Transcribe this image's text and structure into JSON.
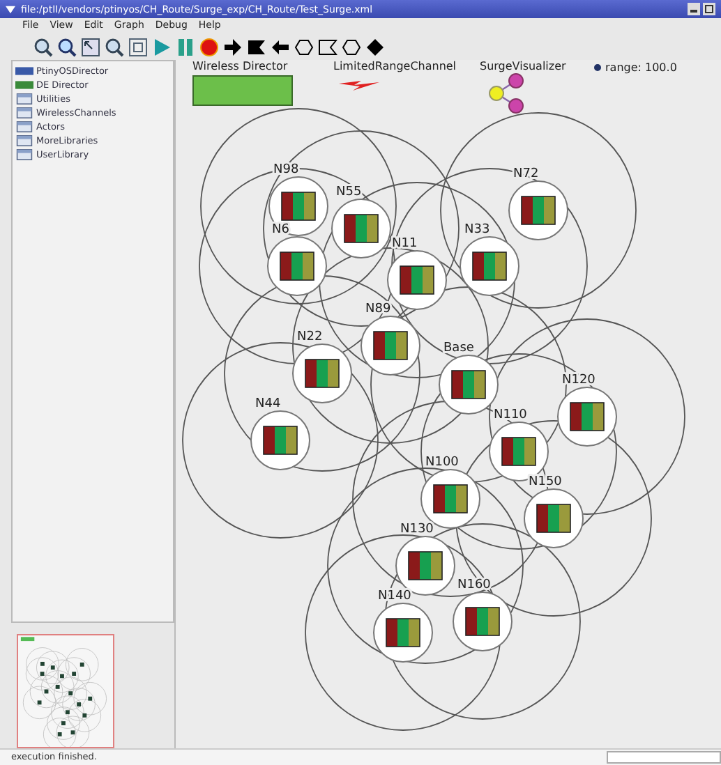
{
  "window": {
    "title": "file:/ptII/vendors/ptinyos/CH_Route/Surge_exp/CH_Route/Test_Surge.xml"
  },
  "menu": [
    "File",
    "View",
    "Edit",
    "Graph",
    "Debug",
    "Help"
  ],
  "library": [
    {
      "label": "PtinyOSDirector",
      "kind": "director",
      "color": "#3a5aa8"
    },
    {
      "label": "DE Director",
      "kind": "director",
      "color": "#3a8a3a"
    },
    {
      "label": "Utilities",
      "kind": "folder"
    },
    {
      "label": "WirelessChannels",
      "kind": "folder"
    },
    {
      "label": "Actors",
      "kind": "folder"
    },
    {
      "label": "MoreLibraries",
      "kind": "folder"
    },
    {
      "label": "UserLibrary",
      "kind": "folder"
    }
  ],
  "canvas": {
    "attributes": [
      {
        "label": "Wireless Director",
        "kind": "director"
      },
      {
        "label": "LimitedRangeChannel",
        "kind": "channel"
      },
      {
        "label": "SurgeVisualizer",
        "kind": "visualizer"
      },
      {
        "label": "range: 100.0",
        "kind": "parameter"
      }
    ],
    "nodes": [
      {
        "label": "N98"
      },
      {
        "label": "N55"
      },
      {
        "label": "N6"
      },
      {
        "label": "N11"
      },
      {
        "label": "N33"
      },
      {
        "label": "N72"
      },
      {
        "label": "N89"
      },
      {
        "label": "N22"
      },
      {
        "label": "Base"
      },
      {
        "label": "N44"
      },
      {
        "label": "N120"
      },
      {
        "label": "N110"
      },
      {
        "label": "N100"
      },
      {
        "label": "N150"
      },
      {
        "label": "N130"
      },
      {
        "label": "N160"
      },
      {
        "label": "N140"
      }
    ]
  },
  "status_bar": {
    "message": "execution finished."
  }
}
